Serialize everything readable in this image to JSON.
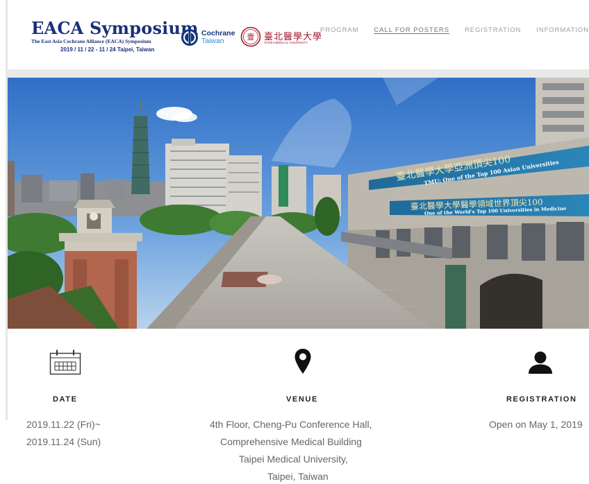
{
  "brand": {
    "title": "EACA Symposium",
    "subtitle": "The East Asia Cochrane Alliance (EACA) Symposium",
    "dates": "2019 / 11 / 22 - 11 / 24  Taipei, Taiwan"
  },
  "partners": {
    "cochrane": {
      "line1": "Cochrane",
      "line2": "Taiwan",
      "icon": "cochrane-logo-icon"
    },
    "tmu": {
      "name_zh": "臺北醫學大學",
      "name_en": "TAIPEI MEDICAL UNIVERSITY",
      "seal": "tmu-seal-icon"
    }
  },
  "nav": {
    "items": [
      {
        "label": "PROGRAM",
        "active": false
      },
      {
        "label": "CALL FOR POSTERS",
        "active": true
      },
      {
        "label": "REGISTRATION",
        "active": false
      },
      {
        "label": "INFORMATION",
        "active": false
      }
    ]
  },
  "hero": {
    "banner_top_zh": "臺北醫學大學亞洲頂尖100",
    "banner_top_en": "TMU: One of the Top 100 Asian Universities",
    "banner_bottom_zh": "臺北醫學大學醫學領域世界頂尖100",
    "banner_bottom_en": "One of the World's Top 100 Universities in Medicine",
    "colors": {
      "sky": "#3b7fd0",
      "building": "#d9d6cf",
      "green": "#3f7a32"
    }
  },
  "info": {
    "date": {
      "icon": "calendar-icon",
      "title": "DATE",
      "line1": "2019.11.22 (Fri)~",
      "line2": "2019.11.24 (Sun)"
    },
    "venue": {
      "icon": "map-pin-icon",
      "title": "VENUE",
      "line1": "4th Floor, Cheng-Pu Conference Hall,",
      "line2": "Comprehensive Medical Building",
      "line3": "Taipei Medical University,",
      "line4": "Taipei, Taiwan"
    },
    "registration": {
      "icon": "user-icon",
      "title": "REGISTRATION",
      "line1": "Open on May 1, 2019"
    }
  }
}
